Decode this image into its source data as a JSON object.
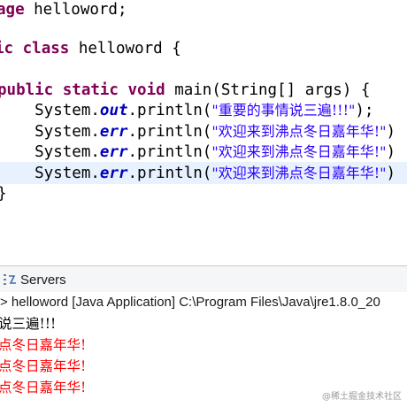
{
  "editor": {
    "lines": {
      "l1": {
        "kw": "age",
        "rest": " helloword;"
      },
      "l2": {
        "kw1": "ic",
        "sp": " ",
        "kw2": "class",
        "rest": " helloword {"
      },
      "l3": {
        "kw": "public static void",
        "rest": " main(String[] args) {"
      },
      "l4": {
        "pre": "    System.",
        "field": "out",
        "call": ".println(",
        "str": "\"重要的事情说三遍!!!\"",
        "end": ");"
      },
      "l5": {
        "pre": "    System.",
        "field": "err",
        "call": ".println(",
        "str": "\"欢迎来到沸点冬日嘉年华!\"",
        "end": ")"
      },
      "l6": {
        "pre": "    System.",
        "field": "err",
        "call": ".println(",
        "str": "\"欢迎来到沸点冬日嘉年华!\"",
        "end": ")"
      },
      "l7": {
        "pre": "    System.",
        "field": "err",
        "call": ".println(",
        "str": "\"欢迎来到沸点冬日嘉年华!\"",
        "end": ")"
      },
      "l8": {
        "text": "}"
      }
    }
  },
  "panel": {
    "tab_label": "Servers",
    "tab_icon": "servers-icon"
  },
  "console": {
    "header": "> helloword [Java Application] C:\\Program Files\\Java\\jre1.8.0_20",
    "lines": [
      "说三遍!!!",
      "点冬日嘉年华!",
      "点冬日嘉年华!",
      "点冬日嘉年华!"
    ],
    "out_color": "#000000",
    "err_color": "#ff0000"
  },
  "watermark": "@稀土掘金技术社区"
}
